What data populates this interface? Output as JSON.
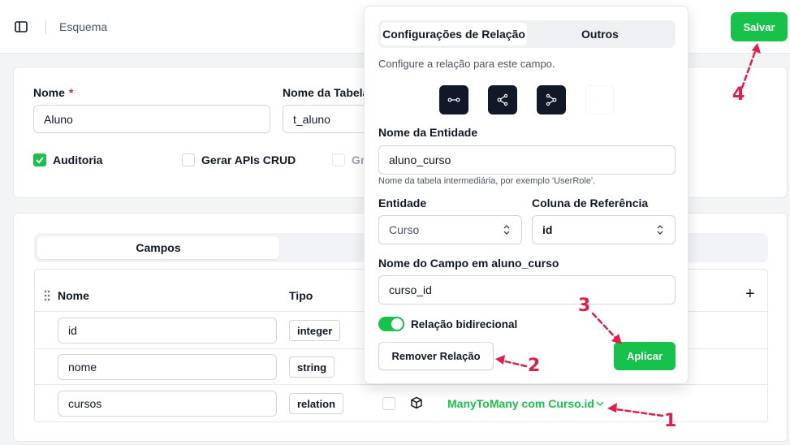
{
  "header": {
    "breadcrumb": "Esquema",
    "save_label": "Salvar"
  },
  "form": {
    "name_label": "Nome",
    "name_required_mark": "*",
    "name_value": "Aluno",
    "table_label": "Nome da Tabela",
    "table_value": "t_aluno",
    "checkboxes": [
      {
        "label": "Auditoria",
        "checked": true
      },
      {
        "label": "Gerar APIs CRUD",
        "checked": false
      },
      {
        "label": "Gr",
        "checked": false
      }
    ]
  },
  "fields": {
    "tab_label": "Campos",
    "columns": {
      "name": "Nome",
      "type": "Tipo"
    },
    "add_symbol": "+",
    "rows": [
      {
        "name": "id",
        "type": "integer"
      },
      {
        "name": "nome",
        "type": "string"
      },
      {
        "name": "cursos",
        "type": "relation",
        "relation": "ManyToMany com Curso.id"
      }
    ]
  },
  "popover": {
    "tabs": [
      "Configurações de Relação",
      "Outros"
    ],
    "description": "Configure a relação para este campo.",
    "entity_name_label": "Nome da Entidade",
    "entity_name_value": "aluno_curso",
    "entity_name_hint": "Nome da tabela intermediária, por exemplo 'UserRole'.",
    "entity_label": "Entidade",
    "entity_value": "Curso",
    "ref_column_label": "Coluna de Referência",
    "ref_column_value": "id",
    "field_name_label": "Nome do Campo em aluno_curso",
    "field_name_value": "curso_id",
    "bidirectional_label": "Relação bidirecional",
    "bidirectional_on": true,
    "remove_label": "Remover Relação",
    "apply_label": "Aplicar"
  },
  "annotations": [
    "1",
    "2",
    "3",
    "4"
  ],
  "colors": {
    "accent": "#16c24a",
    "annotation": "#e11d48",
    "dark_icon": "#111827"
  }
}
